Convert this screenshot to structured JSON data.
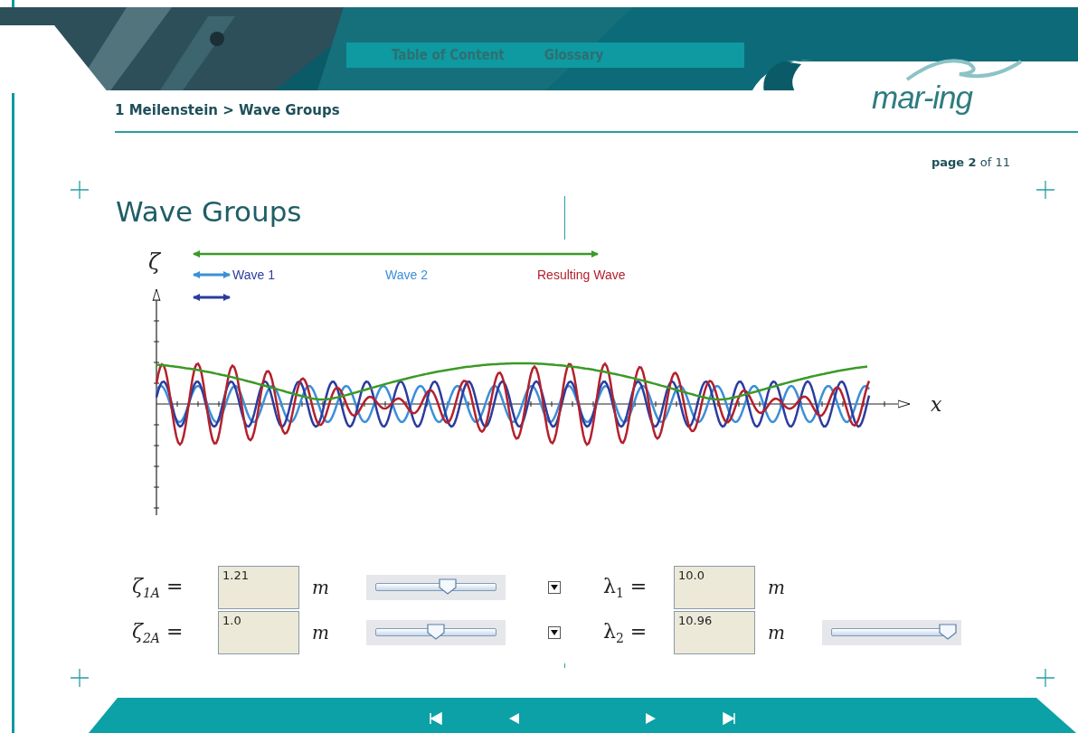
{
  "header": {
    "nav_links": [
      "Table of Content",
      "Glossary"
    ],
    "logo": "mar-ing"
  },
  "breadcrumb": "1 Meilenstein > Wave Groups",
  "page_indicator": "**page 2** of 11",
  "title": "Wave Groups",
  "plot": {
    "y_axis_label": "ζ",
    "x_axis_label": "x",
    "legend": [
      {
        "label": "Wave 1",
        "color": "#2b3c9e"
      },
      {
        "label": "Wave 2",
        "color": "#3b8fd9"
      },
      {
        "label": "Resulting Wave",
        "color": "#b3212c"
      }
    ]
  },
  "parameters": [
    {
      "amplitude": {
        "symbol": "ζ$_{1A}$ =",
        "value": "1.21",
        "unit": "m",
        "level": 0.6
      },
      "checked": true,
      "wavelength": {
        "symbol": "λ$_{1}$ =",
        "value": "10.0",
        "unit": "m"
      }
    },
    {
      "amplitude": {
        "symbol": "ζ$_{2A}$ =",
        "value": "1.0",
        "unit": "m",
        "level": 0.5
      },
      "checked": true,
      "wavelength": {
        "symbol": "λ$_{2}$ =",
        "value": "10.96",
        "unit": "m",
        "level": 0.97
      }
    }
  ]
}
